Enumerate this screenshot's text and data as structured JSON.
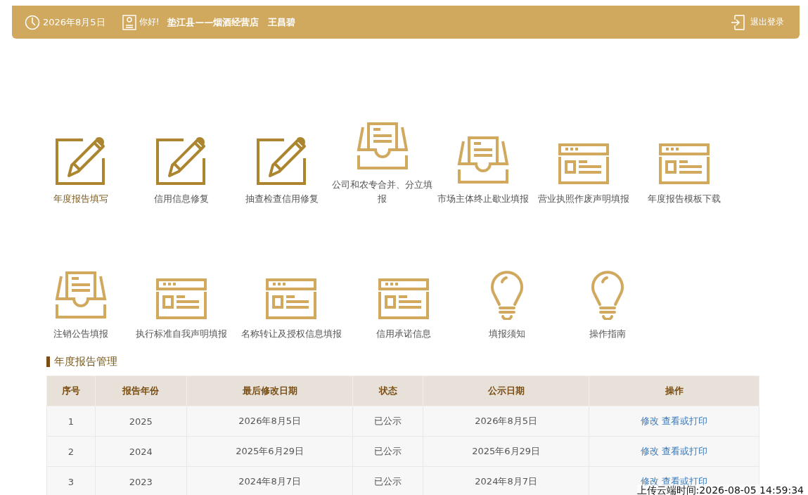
{
  "header": {
    "date": "2026年8月5日",
    "greeting": "你好!",
    "user": "垫江县——烟酒经营店　王昌碧",
    "logout": "退出登录"
  },
  "tile_rows": [
    [
      {
        "kind": "pen",
        "label": "年度报告填写",
        "selected": true
      },
      {
        "kind": "pen",
        "label": "信用信息修复",
        "selected": false
      },
      {
        "kind": "pen",
        "label": "抽查检查信用修复",
        "selected": false
      },
      {
        "kind": "tray",
        "label": "公司和农专合并、分立填报",
        "selected": false
      },
      {
        "kind": "tray",
        "label": "市场主体终止歇业填报",
        "selected": false
      },
      {
        "kind": "window",
        "label": "营业执照作废声明填报",
        "selected": false
      },
      {
        "kind": "window",
        "label": "年度报告模板下载",
        "selected": false
      }
    ],
    [
      {
        "kind": "tray",
        "label": "注销公告填报",
        "selected": false
      },
      {
        "kind": "window",
        "label": "执行标准自我声明填报",
        "selected": false
      },
      {
        "kind": "window",
        "label": "名称转让及授权信息填报",
        "selected": false
      },
      {
        "kind": "window",
        "label": "信用承诺信息",
        "selected": false
      },
      {
        "kind": "bulb",
        "label": "填报须知",
        "selected": false
      },
      {
        "kind": "bulb",
        "label": "操作指南",
        "selected": false
      }
    ]
  ],
  "section_title": "年度报告管理",
  "table": {
    "columns": [
      "序号",
      "报告年份",
      "最后修改日期",
      "状态",
      "公示日期",
      "操作"
    ],
    "rows": [
      {
        "cells": [
          "1",
          "2025",
          "2026年8月5日",
          "已公示",
          "2026年8月5日"
        ],
        "actions": [
          "修改",
          "查看或打印"
        ]
      },
      {
        "cells": [
          "2",
          "2024",
          "2025年6月29日",
          "已公示",
          "2025年6月29日"
        ],
        "actions": [
          "修改",
          "查看或打印"
        ]
      },
      {
        "cells": [
          "3",
          "2023",
          "2024年8月7日",
          "已公示",
          "2024年8月7日"
        ],
        "actions": [
          "修改",
          "查看或打印"
        ]
      }
    ]
  },
  "upload_time": "上传云端时间:2026-08-05 14:59:34"
}
